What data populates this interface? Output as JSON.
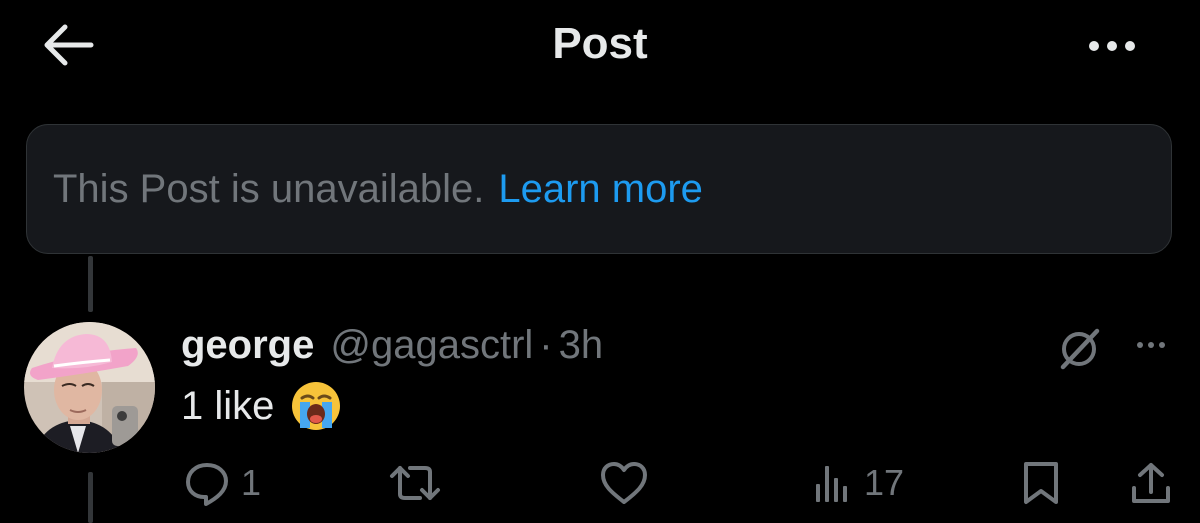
{
  "header": {
    "title": "Post",
    "back_icon": "arrow-left-icon",
    "more_icon": "more-horizontal-icon"
  },
  "unavailable": {
    "message": "This Post is unavailable.",
    "link_label": "Learn more"
  },
  "reply": {
    "display_name": "george",
    "handle": "@gagasctrl",
    "separator": "·",
    "time": "3h",
    "text": "1 like",
    "emoji": "loudly-crying-face",
    "actions": {
      "reply_count": "1",
      "views_count": "17"
    }
  },
  "colors": {
    "background": "#000000",
    "text_primary": "#e7e9ea",
    "text_secondary": "#71767b",
    "link": "#1d9bf0",
    "card_bg": "#16181c",
    "border": "#2f3336"
  }
}
